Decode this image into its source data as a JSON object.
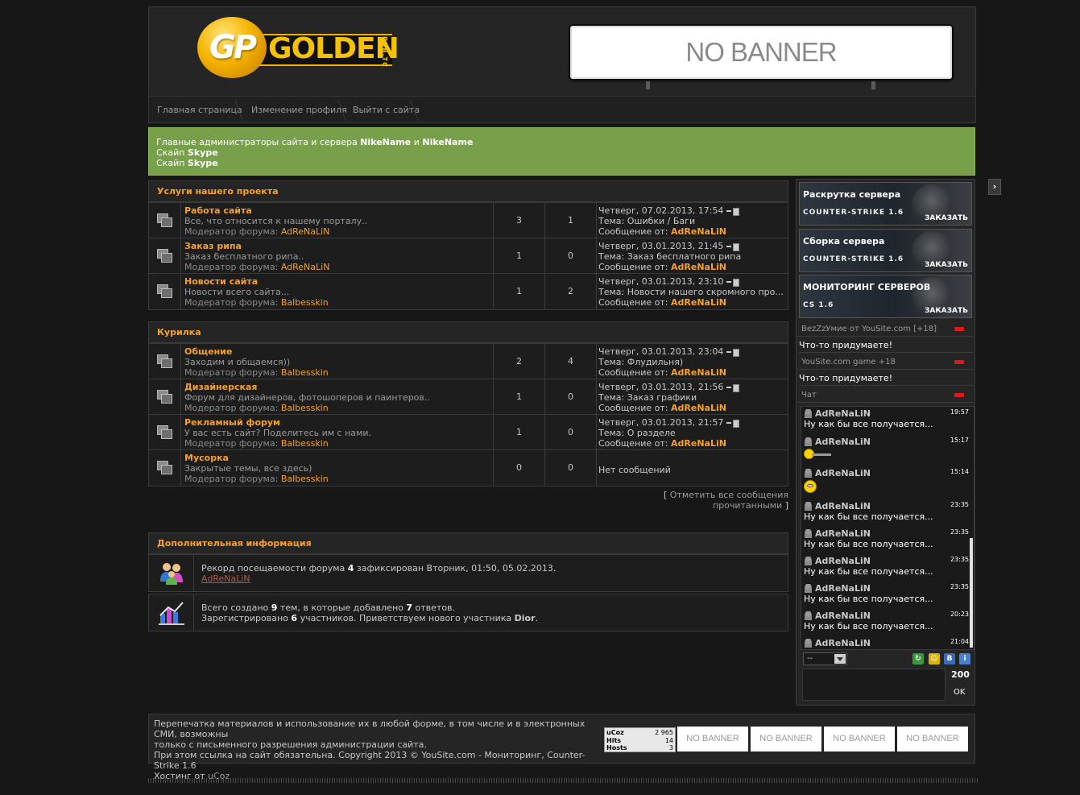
{
  "header": {
    "logo": {
      "mark": "GP",
      "word": "GOLDEN",
      "sub": "PUB.TC"
    },
    "banner": "NO BANNER",
    "nav": [
      "Главная страница",
      "Изменение профиля",
      "Выйти с сайта"
    ]
  },
  "notice": {
    "line1_prefix": "Главные администраторы сайта и сервера",
    "admin1": "NikeName",
    "and": "и",
    "admin2": "NikeName",
    "line2_prefix": "Скайп",
    "line2_value": "Skype",
    "line3_prefix": "Скайп",
    "line3_value": "Skype"
  },
  "categories": [
    {
      "title": "Услуги нашего проекта",
      "forums": [
        {
          "name": "Работа сайта",
          "desc": "Все, что относится к нашему порталу..",
          "mod_label": "Модератор форума:",
          "mod": "AdReNaLiN",
          "threads": "3",
          "posts": "1",
          "last_date": "Четверг, 07.02.2013, 17:54",
          "last_topic": "Тема: Ошибки / Баги",
          "last_by_label": "Сообщение от:",
          "last_by": "AdReNaLiN"
        },
        {
          "name": "Заказ рипа",
          "desc": "Заказ бесплатного рипа..",
          "mod_label": "Модератор форума:",
          "mod": "AdReNaLiN",
          "threads": "1",
          "posts": "0",
          "last_date": "Четверг, 03.01.2013, 21:45",
          "last_topic": "Тема: Заказ бесплатного рипа",
          "last_by_label": "Сообщение от:",
          "last_by": "AdReNaLiN"
        },
        {
          "name": "Новости сайта",
          "desc": "Новости всего сайта...",
          "mod_label": "Модератор форума:",
          "mod": "Balbesskin",
          "threads": "1",
          "posts": "2",
          "last_date": "Четверг, 03.01.2013, 23:10",
          "last_topic": "Тема: Новости нашего скромного про...",
          "last_by_label": "Сообщение от:",
          "last_by": "AdReNaLiN"
        }
      ]
    },
    {
      "title": "Курилка",
      "forums": [
        {
          "name": "Общение",
          "desc": "Заходим и общаемся))",
          "mod_label": "Модератор форума:",
          "mod": "Balbesskin",
          "threads": "2",
          "posts": "4",
          "last_date": "Четверг, 03.01.2013, 23:04",
          "last_topic": "Тема: Флудильня)",
          "last_by_label": "Сообщение от:",
          "last_by": "AdReNaLiN"
        },
        {
          "name": "Дизайнерская",
          "desc": "Форум для дизайнеров, фотошоперов и паинтеров..",
          "mod_label": "Модератор форума:",
          "mod": "Balbesskin",
          "threads": "1",
          "posts": "0",
          "last_date": "Четверг, 03.01.2013, 21:56",
          "last_topic": "Тема: Заказ графики",
          "last_by_label": "Сообщение от:",
          "last_by": "AdReNaLiN"
        },
        {
          "name": "Рекламный форум",
          "desc": "У вас есть сайт? Поделитесь им с нами.",
          "mod_label": "Модератор форума:",
          "mod": "Balbesskin",
          "threads": "1",
          "posts": "0",
          "last_date": "Четверг, 03.01.2013, 21:57",
          "last_topic": "Тема: О разделе",
          "last_by_label": "Сообщение от:",
          "last_by": "AdReNaLiN"
        },
        {
          "name": "Мусорка",
          "desc": "Закрытые темы, все здесь)",
          "mod_label": "Модератор форума:",
          "mod": "Balbesskin",
          "threads": "0",
          "posts": "0",
          "no_posts": "Нет сообщений"
        }
      ]
    }
  ],
  "mark_read": {
    "open": "[",
    "label": "Отметить все сообщения прочитанными",
    "close": "]"
  },
  "extra_info": {
    "title": "Дополнительная информация",
    "record_prefix": "Рекорд посещаемости форума",
    "record_count": "4",
    "record_suffix": "зафиксирован Вторник, 01:50, 05.02.2013.",
    "record_user": "AdReNaLiN",
    "stats_1": "Всего создано",
    "stats_threads": "9",
    "stats_2": "тем, в которые добавлено",
    "stats_posts": "7",
    "stats_3": "ответов.",
    "stats_4": "Зарегистрировано",
    "stats_users": "6",
    "stats_5": "участников. Приветствуем нового участника",
    "stats_newuser": "Dior",
    "stats_end": "."
  },
  "sidebar": {
    "toggle": "›",
    "promos": [
      {
        "title": "Раскрутка сервера",
        "sub": "COUNTER-STRIKE 1.6",
        "order": "ЗАКАЗАТЬ"
      },
      {
        "title": "Сборка сервера",
        "sub": "COUNTER-STRIKE 1.6",
        "order": "ЗАКАЗАТЬ"
      },
      {
        "title": "МОНИТОРИНГ СЕРВЕРОВ",
        "sub": "CS 1.6",
        "order": "ЗАКАЗАТЬ"
      }
    ],
    "blocks": [
      {
        "head": "BezZzУмие от YouSite.com [+18]",
        "text": "Что-то придумаете!"
      },
      {
        "head": "YouSite.com game +18",
        "text": "Что-то придумаете!"
      }
    ],
    "chat": {
      "head": "Чат",
      "messages": [
        {
          "user": "AdReNaLiN",
          "time": "19:57",
          "text": "Ну как бы все получается...",
          "kind": "text"
        },
        {
          "user": "AdReNaLiN",
          "time": "15:17",
          "kind": "gun-smiley"
        },
        {
          "user": "AdReNaLiN",
          "time": "15:14",
          "kind": "smiley"
        },
        {
          "user": "AdReNaLiN",
          "time": "23:35",
          "text": "Ну как бы все получается...",
          "kind": "text"
        },
        {
          "user": "AdReNaLiN",
          "time": "23:35",
          "text": "Ну как бы все получается...",
          "kind": "text"
        },
        {
          "user": "AdReNaLiN",
          "time": "23:35",
          "text": "Ну как бы все получается...",
          "kind": "text"
        },
        {
          "user": "AdReNaLiN",
          "time": "23:35",
          "text": "Ну как бы все получается...",
          "kind": "text"
        },
        {
          "user": "AdReNaLiN",
          "time": "20:23",
          "text": "Ну как бы все получается...",
          "kind": "text"
        },
        {
          "user": "AdReNaLiN",
          "time": "21:04",
          "kind": "text",
          "text": ""
        }
      ],
      "select_value": "--",
      "counter": "200",
      "ok_label": "OK"
    }
  },
  "footer": {
    "line1": "Перепечатка материалов и использование их в любой форме, в том числе и в электронных СМИ, возможны",
    "line2": "только с письменного разрешения администрации сайта.",
    "line3": "При этом ссылка на сайт обязательна. Copyright 2013 © YouSite.com - Мониторинг, Counter-Strike 1.6",
    "line4_prefix": "Хостинг от",
    "line4_link": "uCoz",
    "counter": {
      "brand": "uCoz",
      "total": "2 965",
      "hits_label": "Hits",
      "hits": "14",
      "hosts_label": "Hosts",
      "hosts": "3"
    },
    "banners": [
      "NO BANNER",
      "NO BANNER",
      "NO BANNER",
      "NO BANNER"
    ]
  },
  "colors": {
    "background": "#171717",
    "panel": "#252525",
    "border": "#3a3a3a",
    "accent_orange": "#f5a12a",
    "notice_green": "#78a04a",
    "logo_gold": "#f6c200",
    "minimize_red": "#e01818"
  },
  "icons": [
    "folder-icon",
    "users-icon",
    "stats-chart-icon",
    "arrow-right-icon",
    "user-icon",
    "refresh-icon",
    "smiley-icon",
    "vk-icon",
    "info-icon"
  ]
}
